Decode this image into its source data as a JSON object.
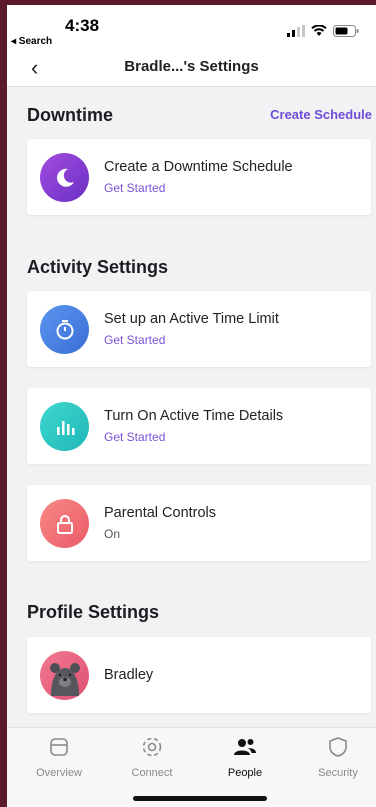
{
  "status": {
    "time": "4:38",
    "back_label": "◂ Search"
  },
  "nav": {
    "title": "Bradle...'s Settings"
  },
  "downtime": {
    "header": "Downtime",
    "create_link": "Create Schedule",
    "card": {
      "title": "Create a Downtime Schedule",
      "subtitle": "Get Started",
      "icon": "moon-icon",
      "color": "#8a3fd1"
    }
  },
  "activity": {
    "header": "Activity Settings",
    "cards": [
      {
        "title": "Set up an Active Time Limit",
        "subtitle": "Get Started",
        "icon": "timer-icon",
        "color": "#4a7fe0"
      },
      {
        "title": "Turn On Active Time Details",
        "subtitle": "Get Started",
        "icon": "bar-chart-icon",
        "color": "#27c7c2"
      },
      {
        "title": "Parental Controls",
        "subtitle": "On",
        "icon": "lock-icon",
        "color": "#f06b6b"
      }
    ]
  },
  "profile": {
    "header": "Profile Settings",
    "card": {
      "name": "Bradley",
      "icon": "bear-avatar"
    }
  },
  "tabbar": {
    "items": [
      {
        "label": "Overview",
        "icon": "overview-icon",
        "active": false
      },
      {
        "label": "Connect",
        "icon": "connect-icon",
        "active": false
      },
      {
        "label": "People",
        "icon": "people-icon",
        "active": true
      },
      {
        "label": "Security",
        "icon": "shield-icon",
        "active": false
      }
    ]
  }
}
